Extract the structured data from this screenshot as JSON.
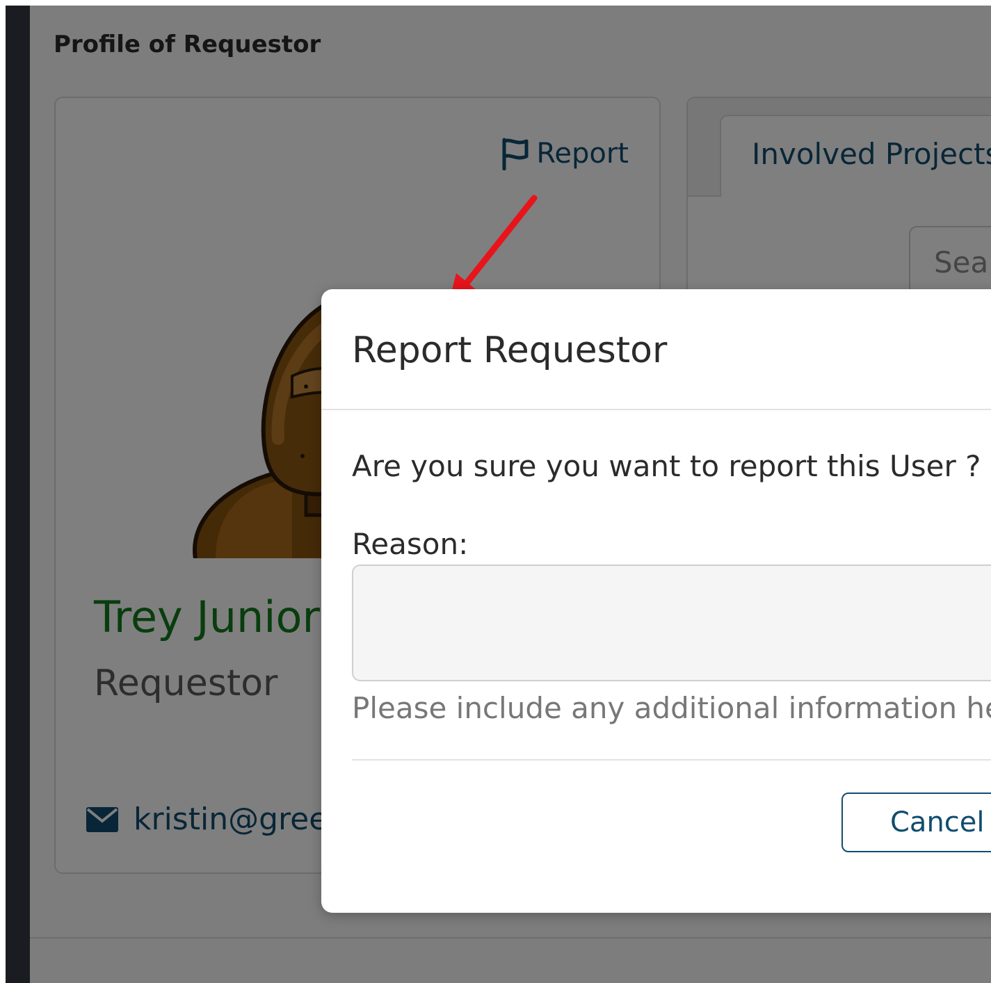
{
  "page": {
    "heading": "Profile of Requestor"
  },
  "profile": {
    "report_label": "Report",
    "name": "Trey Junior",
    "role": "Requestor",
    "email": "kristin@green"
  },
  "projects": {
    "tab_label": "Involved Projects/",
    "search_placeholder": "Sear"
  },
  "modal": {
    "title": "Report Requestor",
    "question": "Are you sure you want to report this User ?",
    "reason_label": "Reason:",
    "reason_value": "",
    "reason_help": "Please include any additional information here.",
    "cancel_label": "Cancel"
  },
  "icons": {
    "report": "flag-icon",
    "email": "envelope-icon"
  },
  "colors": {
    "link": "#104d6e",
    "name": "#127a1c",
    "annotation": "#e8141b",
    "overlay": "rgba(0,0,0,0.5)"
  }
}
